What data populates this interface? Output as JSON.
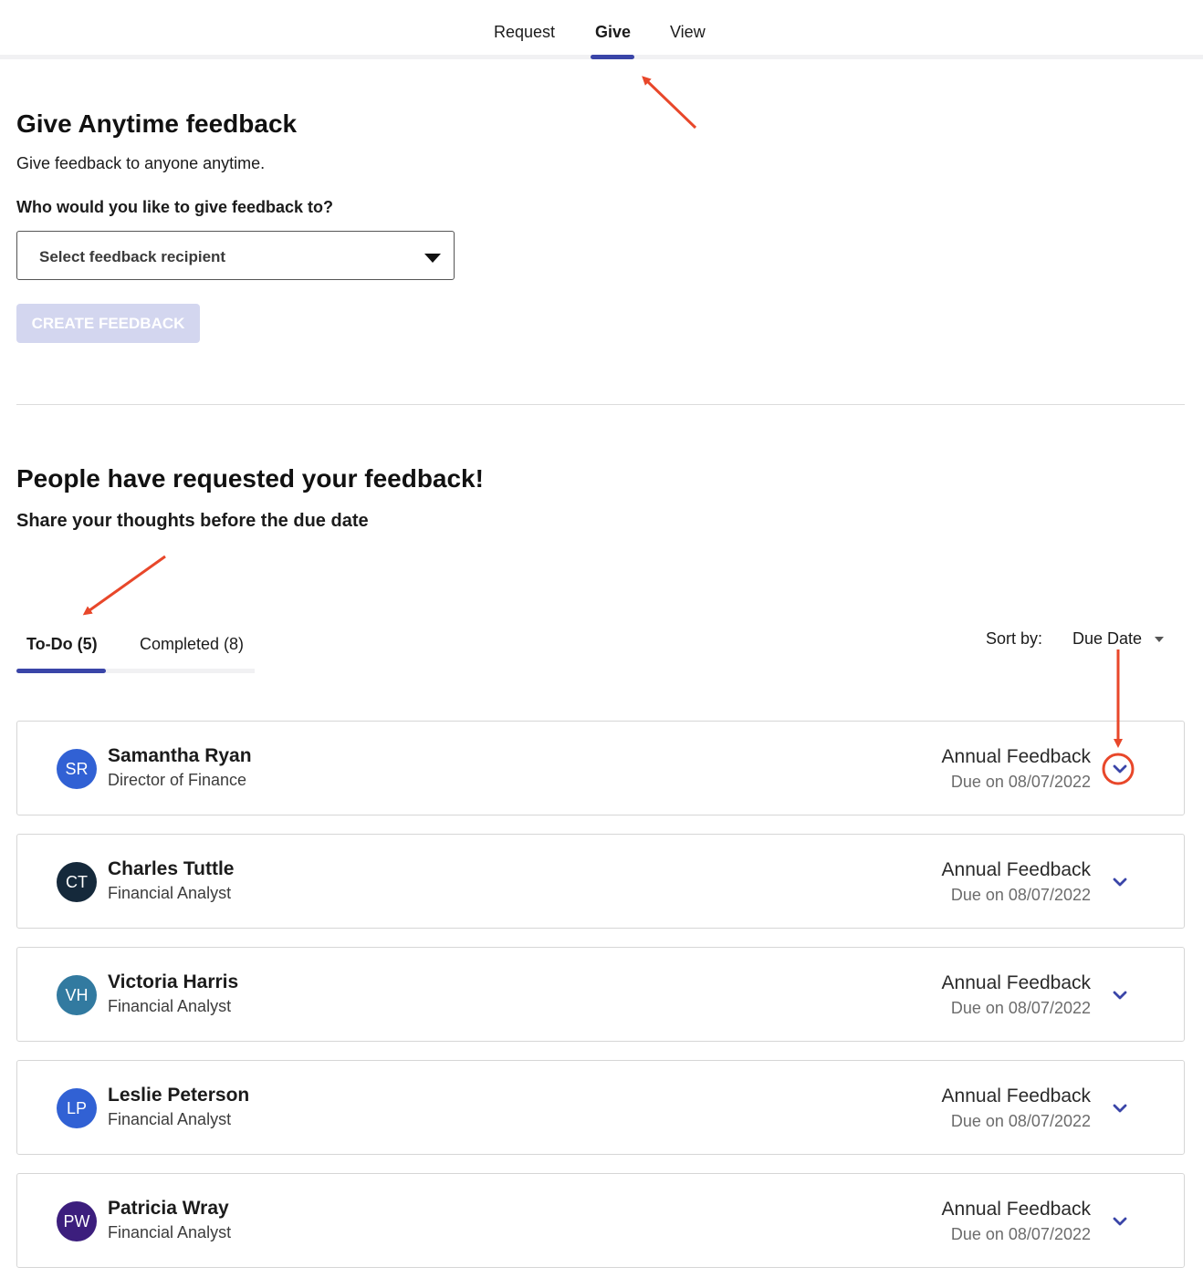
{
  "nav": {
    "tabs": [
      {
        "label": "Request"
      },
      {
        "label": "Give"
      },
      {
        "label": "View"
      }
    ],
    "active": "Give"
  },
  "anytime": {
    "title": "Give Anytime feedback",
    "subtitle": "Give feedback to anyone anytime.",
    "question": "Who would you like to give feedback to?",
    "select_placeholder": "Select feedback recipient",
    "create_button": "CREATE FEEDBACK"
  },
  "requests": {
    "title": "People have requested your feedback!",
    "subtitle": "Share your thoughts before the due date",
    "tabs": [
      {
        "label": "To-Do (5)"
      },
      {
        "label": "Completed (8)"
      }
    ],
    "sort_label": "Sort by:",
    "sort_value": "Due Date",
    "items": [
      {
        "initials": "SR",
        "name": "Samantha Ryan",
        "role": "Director of Finance",
        "type": "Annual Feedback",
        "due": "Due on 08/07/2022",
        "avatar_color": "#3161d4"
      },
      {
        "initials": "CT",
        "name": "Charles Tuttle",
        "role": "Financial Analyst",
        "type": "Annual Feedback",
        "due": "Due on 08/07/2022",
        "avatar_color": "#15293b"
      },
      {
        "initials": "VH",
        "name": "Victoria Harris",
        "role": "Financial Analyst",
        "type": "Annual Feedback",
        "due": "Due on 08/07/2022",
        "avatar_color": "#327aa0"
      },
      {
        "initials": "LP",
        "name": "Leslie Peterson",
        "role": "Financial Analyst",
        "type": "Annual Feedback",
        "due": "Due on 08/07/2022",
        "avatar_color": "#3161d4"
      },
      {
        "initials": "PW",
        "name": "Patricia Wray",
        "role": "Financial Analyst",
        "type": "Annual Feedback",
        "due": "Due on 08/07/2022",
        "avatar_color": "#3c1e7d"
      }
    ]
  },
  "colors": {
    "accent": "#3a45a8",
    "annotation": "#e8472a",
    "disabled_button": "#d3d6ef"
  }
}
